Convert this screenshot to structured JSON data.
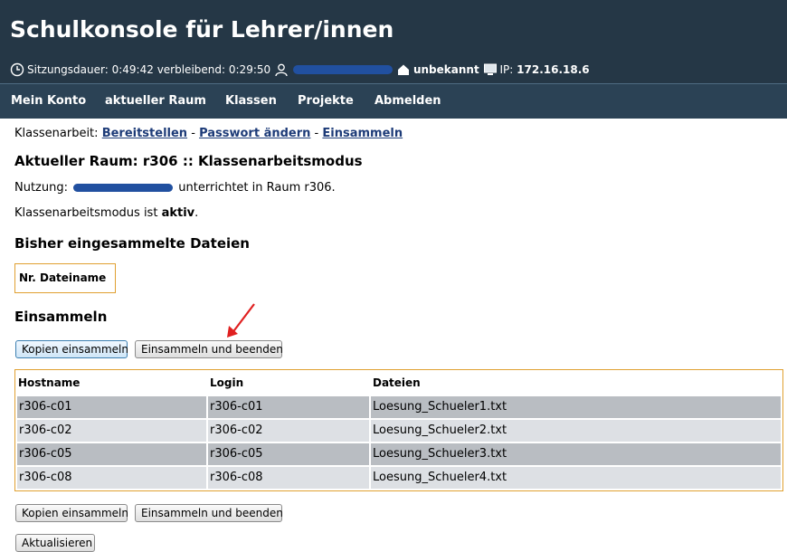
{
  "app": {
    "title": "Schulkonsole für Lehrer/innen",
    "session_label": "Sitzungsdauer:",
    "session_duration": "0:49:42",
    "remaining_label": "verbleibend:",
    "remaining_time": "0:29:50",
    "host_label": "unbekannt",
    "ip_label": "IP:",
    "ip": "172.16.18.6"
  },
  "nav": {
    "items": [
      "Mein Konto",
      "aktueller Raum",
      "Klassen",
      "Projekte",
      "Abmelden"
    ]
  },
  "crumb": {
    "prefix": "Klassenarbeit:",
    "links": [
      "Bereitstellen",
      "Passwort ändern",
      "Einsammeln"
    ],
    "sep": "-"
  },
  "room": {
    "title": "Aktueller Raum: r306 :: Klassenarbeitsmodus",
    "usage_prefix": "Nutzung:",
    "usage_suffix": "unterrichtet in Raum r306.",
    "mode_prefix": "Klassenarbeitsmodus ist",
    "mode_value": "aktiv",
    "mode_suffix": "."
  },
  "collected": {
    "heading": "Bisher eingesammelte Dateien",
    "header": "Nr. Dateiname"
  },
  "collect": {
    "heading": "Einsammeln",
    "btn_copy": "Kopien einsammeln",
    "btn_collect_end": "Einsammeln und beenden",
    "btn_refresh": "Aktualisieren"
  },
  "table": {
    "headers": [
      "Hostname",
      "Login",
      "Dateien"
    ],
    "rows": [
      [
        "r306-c01",
        "r306-c01",
        "Loesung_Schueler1.txt"
      ],
      [
        "r306-c02",
        "r306-c02",
        "Loesung_Schueler2.txt"
      ],
      [
        "r306-c05",
        "r306-c05",
        "Loesung_Schueler3.txt"
      ],
      [
        "r306-c08",
        "r306-c08",
        "Loesung_Schueler4.txt"
      ]
    ]
  },
  "colors": {
    "header_bg": "#253746",
    "nav_bg": "#2b4255",
    "link": "#1d3b78",
    "border_accent": "#e0a030",
    "row_dark": "#b9bdc2",
    "row_light": "#dde0e4",
    "annotation_arrow": "#e02020"
  }
}
